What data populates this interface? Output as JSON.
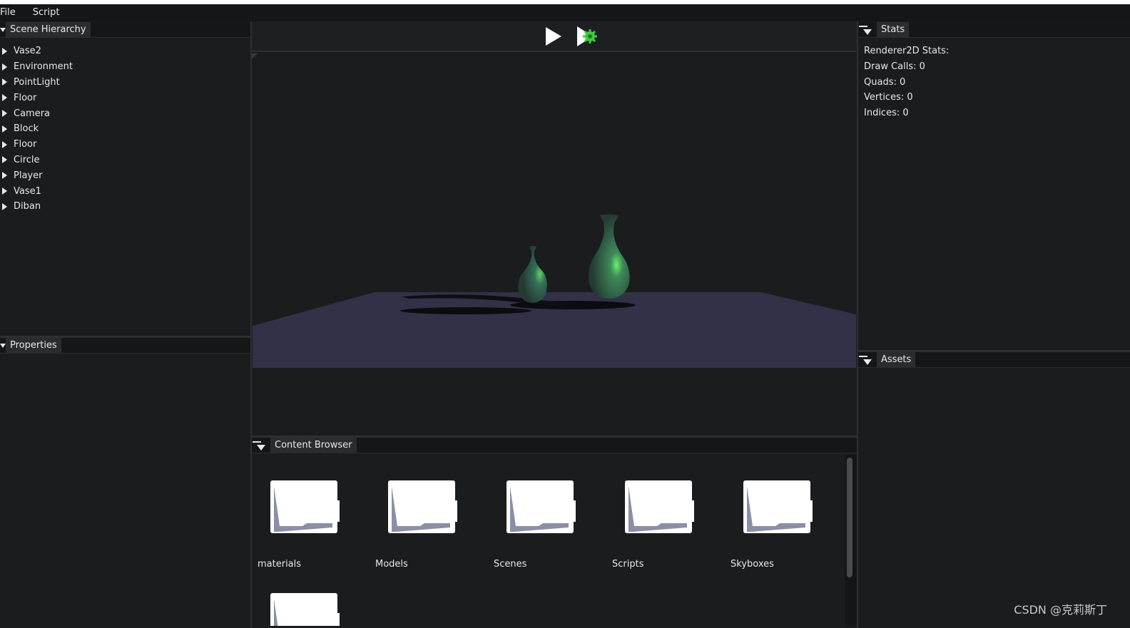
{
  "menu": {
    "file": "File",
    "script": "Script"
  },
  "scene_hierarchy": {
    "title": "Scene Hierarchy",
    "items": [
      {
        "label": "Vase2"
      },
      {
        "label": "Environment"
      },
      {
        "label": "PointLight"
      },
      {
        "label": "Floor"
      },
      {
        "label": "Camera"
      },
      {
        "label": "Block"
      },
      {
        "label": "Floor"
      },
      {
        "label": "Circle"
      },
      {
        "label": "Player"
      },
      {
        "label": "Vase1"
      },
      {
        "label": "Diban"
      }
    ]
  },
  "properties": {
    "title": "Properties"
  },
  "toolbar": {
    "play_icon": "play-icon",
    "simulate_icon": "simulate-icon"
  },
  "stats": {
    "title": "Stats",
    "lines": [
      "Renderer2D Stats:",
      "Draw Calls: 0",
      "Quads: 0",
      "Vertices: 0",
      "Indices: 0"
    ]
  },
  "assets": {
    "title": "Assets"
  },
  "content_browser": {
    "title": "Content Browser",
    "folders": [
      {
        "label": "materials"
      },
      {
        "label": "Models"
      },
      {
        "label": "Scenes"
      },
      {
        "label": "Scripts"
      },
      {
        "label": "Skyboxes"
      },
      {
        "label": ""
      }
    ]
  },
  "watermark": "CSDN @克莉斯丁",
  "colors": {
    "background": "#1b1c1e",
    "header": "#151617",
    "tab": "#2b2c2f",
    "floor": "#323148",
    "vase": "#2f4a40",
    "highlight": "#3ecb3e"
  }
}
